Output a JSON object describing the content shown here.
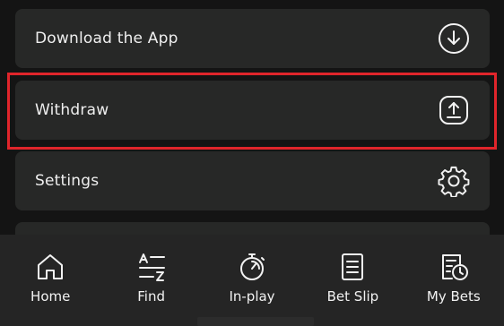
{
  "menu": {
    "items": [
      {
        "label": "Download the App",
        "icon": "download-circle-icon"
      },
      {
        "label": "Withdraw",
        "icon": "upload-tray-icon"
      },
      {
        "label": "Settings",
        "icon": "gear-icon"
      }
    ]
  },
  "highlight": {
    "color": "#e0252b",
    "target": "Withdraw"
  },
  "bottom_nav": {
    "items": [
      {
        "label": "Home",
        "icon": "home-icon"
      },
      {
        "label": "Find",
        "icon": "a-to-z-icon"
      },
      {
        "label": "In-play",
        "icon": "stopwatch-icon"
      },
      {
        "label": "Bet Slip",
        "icon": "document-icon"
      },
      {
        "label": "My Bets",
        "icon": "receipt-clock-icon"
      }
    ]
  },
  "colors": {
    "background": "#141414",
    "card": "#272827",
    "nav_background": "#252525",
    "text": "#efefef"
  }
}
